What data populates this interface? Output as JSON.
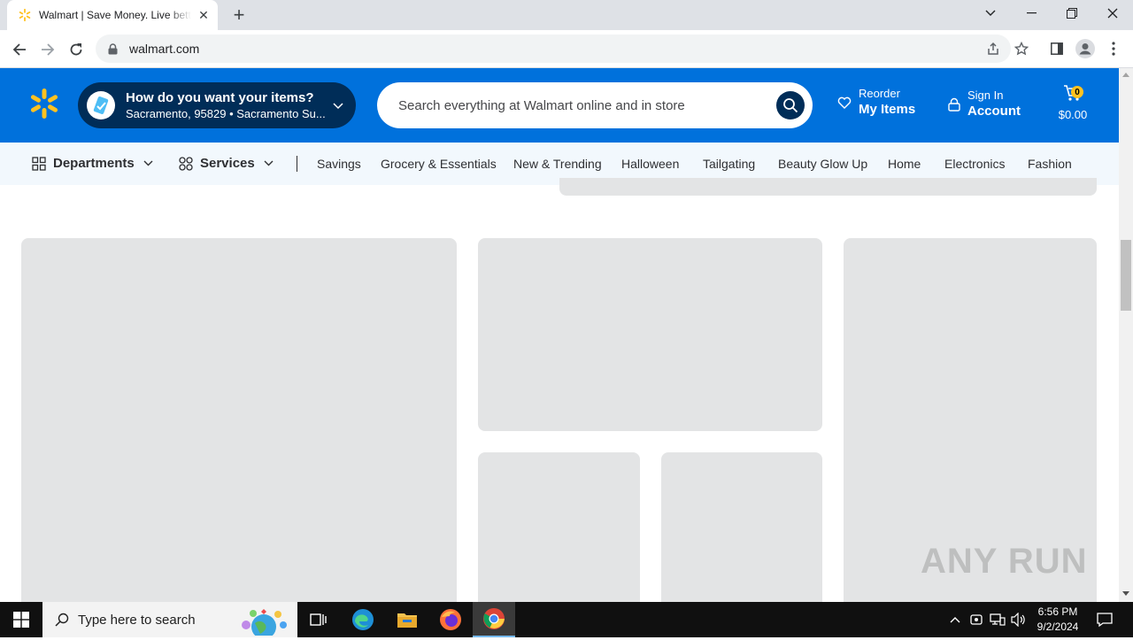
{
  "browser": {
    "tab_title": "Walmart | Save Money. Live better.",
    "url": "walmart.com"
  },
  "header": {
    "fulfillment_title": "How do you want your items?",
    "fulfillment_subtitle": "Sacramento, 95829 • Sacramento Su...",
    "search_placeholder": "Search everything at Walmart online and in store",
    "reorder_small": "Reorder",
    "reorder_big": "My Items",
    "signin_small": "Sign In",
    "signin_big": "Account",
    "cart_count": "0",
    "cart_total": "$0.00"
  },
  "nav": {
    "departments": "Departments",
    "services": "Services",
    "items": [
      "Savings",
      "Grocery & Essentials",
      "New & Trending",
      "Halloween",
      "Tailgating",
      "Beauty Glow Up",
      "Home",
      "Electronics",
      "Fashion"
    ]
  },
  "watermark": "ANY RUN",
  "taskbar": {
    "search_placeholder": "Type here to search",
    "time": "6:56 PM",
    "date": "9/2/2024"
  },
  "colors": {
    "walmart_blue": "#0071dc",
    "walmart_navy": "#002d58",
    "walmart_yellow": "#ffc220",
    "skeleton": "#e3e4e5"
  }
}
